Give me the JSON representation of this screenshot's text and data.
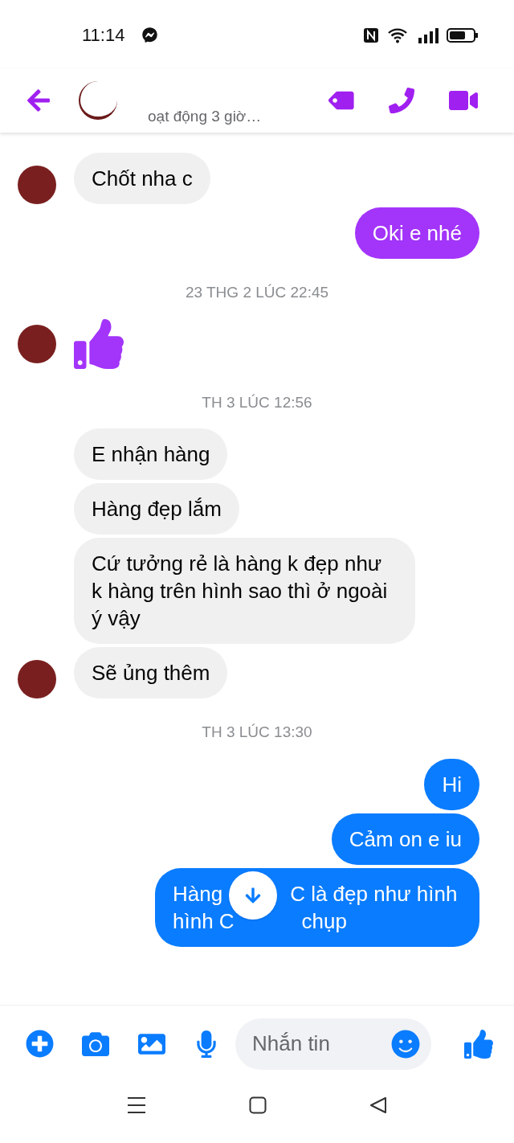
{
  "status_bar": {
    "time": "11:14"
  },
  "header": {
    "activity": "oạt động 3 giờ…"
  },
  "messages": [
    {
      "kind": "received",
      "avatar": true,
      "text": "Chốt nha c"
    },
    {
      "kind": "sent",
      "color": "#a334fa",
      "text": "Oki e nhé"
    },
    {
      "kind": "time",
      "text": "23 THG 2 LÚC 22:45"
    },
    {
      "kind": "like",
      "avatar": true,
      "color": "#a334fa"
    },
    {
      "kind": "time",
      "text": "TH 3 LÚC 12:56"
    },
    {
      "kind": "received",
      "avatar": false,
      "text": "E nhận hàng"
    },
    {
      "kind": "received",
      "avatar": false,
      "text": "Hàng đẹp lắm"
    },
    {
      "kind": "received",
      "avatar": false,
      "text": "Cứ tưởng rẻ là hàng k đẹp như k hàng trên hình sao thì ở ngoài ý vậy"
    },
    {
      "kind": "received",
      "avatar": true,
      "text": "Sẽ ủng thêm"
    },
    {
      "kind": "time",
      "text": "TH 3 LÚC 13:30"
    },
    {
      "kind": "sent",
      "color": "#0a7cff",
      "text": "Hi"
    },
    {
      "kind": "sent",
      "color": "#0a7cff",
      "text": "Cảm on e iu"
    },
    {
      "kind": "covered",
      "color": "#0a7cff",
      "lines": [
        {
          "before": "Hàng",
          "after": "C là đẹp như hình"
        },
        {
          "before": "hình C",
          "after": "chụp"
        }
      ]
    }
  ],
  "composer": {
    "placeholder": "Nhắn tin"
  }
}
